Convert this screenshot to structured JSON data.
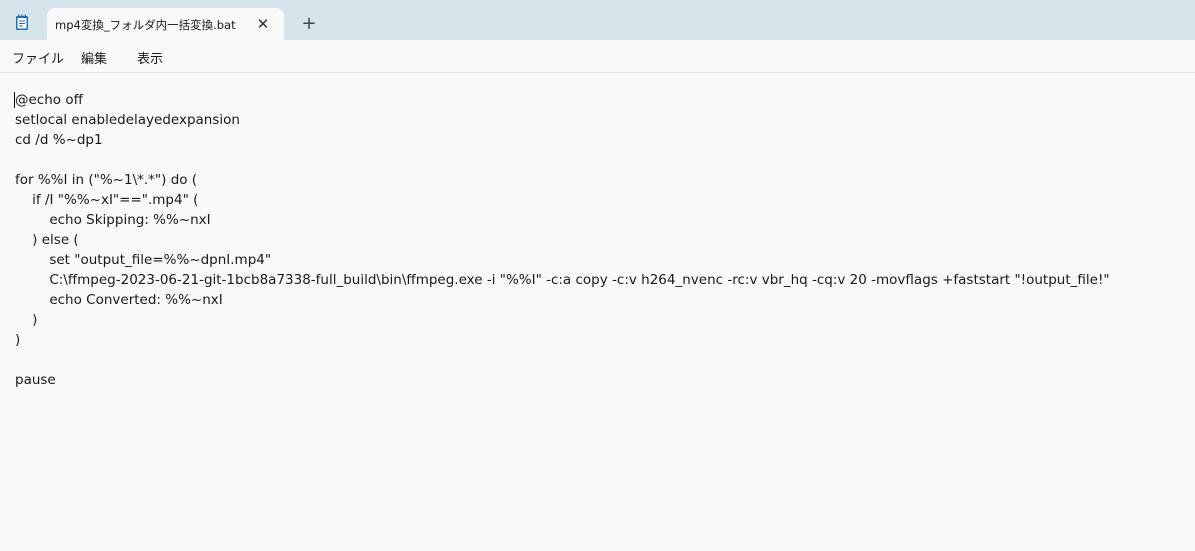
{
  "window": {
    "tab": {
      "title": "mp4変換_フォルダ内一括変換.bat",
      "close_glyph": "✕"
    },
    "new_tab_glyph": "+",
    "app_icon": "notepad-icon"
  },
  "menu": {
    "items": [
      "ファイル",
      "編集",
      "表示"
    ]
  },
  "editor": {
    "lines": [
      "@echo off",
      "setlocal enabledelayedexpansion",
      "cd /d %~dp1",
      "",
      "for %%I in (\"%~1\\*.*\") do (",
      "    if /I \"%%~xI\"==\".mp4\" (",
      "        echo Skipping: %%~nxI",
      "    ) else (",
      "        set \"output_file=%%~dpnI.mp4\"",
      "        C:\\ffmpeg-2023-06-21-git-1bcb8a7338-full_build\\bin\\ffmpeg.exe -i \"%%I\" -c:a copy -c:v h264_nvenc -rc:v vbr_hq -cq:v 20 -movflags +faststart \"!output_file!\"",
      "        echo Converted: %%~nxI",
      "    )",
      ")",
      "",
      "pause"
    ]
  }
}
